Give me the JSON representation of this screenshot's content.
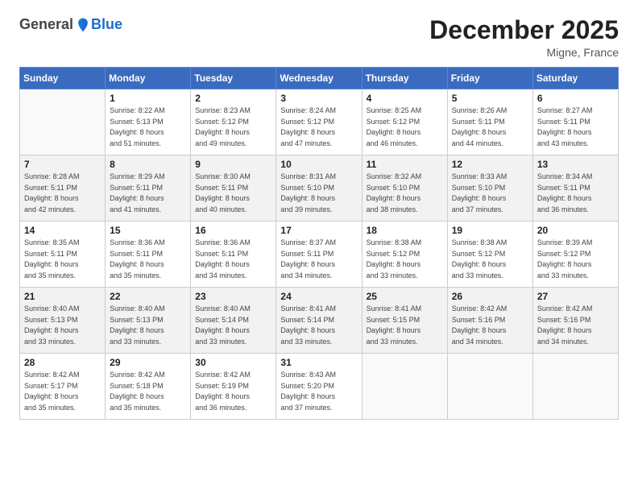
{
  "header": {
    "logo": {
      "general": "General",
      "blue": "Blue"
    },
    "title": "December 2025",
    "location": "Migne, France"
  },
  "weekdays": [
    "Sunday",
    "Monday",
    "Tuesday",
    "Wednesday",
    "Thursday",
    "Friday",
    "Saturday"
  ],
  "weeks": [
    [
      {
        "day": "",
        "info": ""
      },
      {
        "day": "1",
        "info": "Sunrise: 8:22 AM\nSunset: 5:13 PM\nDaylight: 8 hours\nand 51 minutes."
      },
      {
        "day": "2",
        "info": "Sunrise: 8:23 AM\nSunset: 5:12 PM\nDaylight: 8 hours\nand 49 minutes."
      },
      {
        "day": "3",
        "info": "Sunrise: 8:24 AM\nSunset: 5:12 PM\nDaylight: 8 hours\nand 47 minutes."
      },
      {
        "day": "4",
        "info": "Sunrise: 8:25 AM\nSunset: 5:12 PM\nDaylight: 8 hours\nand 46 minutes."
      },
      {
        "day": "5",
        "info": "Sunrise: 8:26 AM\nSunset: 5:11 PM\nDaylight: 8 hours\nand 44 minutes."
      },
      {
        "day": "6",
        "info": "Sunrise: 8:27 AM\nSunset: 5:11 PM\nDaylight: 8 hours\nand 43 minutes."
      }
    ],
    [
      {
        "day": "7",
        "info": "Sunrise: 8:28 AM\nSunset: 5:11 PM\nDaylight: 8 hours\nand 42 minutes."
      },
      {
        "day": "8",
        "info": "Sunrise: 8:29 AM\nSunset: 5:11 PM\nDaylight: 8 hours\nand 41 minutes."
      },
      {
        "day": "9",
        "info": "Sunrise: 8:30 AM\nSunset: 5:11 PM\nDaylight: 8 hours\nand 40 minutes."
      },
      {
        "day": "10",
        "info": "Sunrise: 8:31 AM\nSunset: 5:10 PM\nDaylight: 8 hours\nand 39 minutes."
      },
      {
        "day": "11",
        "info": "Sunrise: 8:32 AM\nSunset: 5:10 PM\nDaylight: 8 hours\nand 38 minutes."
      },
      {
        "day": "12",
        "info": "Sunrise: 8:33 AM\nSunset: 5:10 PM\nDaylight: 8 hours\nand 37 minutes."
      },
      {
        "day": "13",
        "info": "Sunrise: 8:34 AM\nSunset: 5:11 PM\nDaylight: 8 hours\nand 36 minutes."
      }
    ],
    [
      {
        "day": "14",
        "info": "Sunrise: 8:35 AM\nSunset: 5:11 PM\nDaylight: 8 hours\nand 35 minutes."
      },
      {
        "day": "15",
        "info": "Sunrise: 8:36 AM\nSunset: 5:11 PM\nDaylight: 8 hours\nand 35 minutes."
      },
      {
        "day": "16",
        "info": "Sunrise: 8:36 AM\nSunset: 5:11 PM\nDaylight: 8 hours\nand 34 minutes."
      },
      {
        "day": "17",
        "info": "Sunrise: 8:37 AM\nSunset: 5:11 PM\nDaylight: 8 hours\nand 34 minutes."
      },
      {
        "day": "18",
        "info": "Sunrise: 8:38 AM\nSunset: 5:12 PM\nDaylight: 8 hours\nand 33 minutes."
      },
      {
        "day": "19",
        "info": "Sunrise: 8:38 AM\nSunset: 5:12 PM\nDaylight: 8 hours\nand 33 minutes."
      },
      {
        "day": "20",
        "info": "Sunrise: 8:39 AM\nSunset: 5:12 PM\nDaylight: 8 hours\nand 33 minutes."
      }
    ],
    [
      {
        "day": "21",
        "info": "Sunrise: 8:40 AM\nSunset: 5:13 PM\nDaylight: 8 hours\nand 33 minutes."
      },
      {
        "day": "22",
        "info": "Sunrise: 8:40 AM\nSunset: 5:13 PM\nDaylight: 8 hours\nand 33 minutes."
      },
      {
        "day": "23",
        "info": "Sunrise: 8:40 AM\nSunset: 5:14 PM\nDaylight: 8 hours\nand 33 minutes."
      },
      {
        "day": "24",
        "info": "Sunrise: 8:41 AM\nSunset: 5:14 PM\nDaylight: 8 hours\nand 33 minutes."
      },
      {
        "day": "25",
        "info": "Sunrise: 8:41 AM\nSunset: 5:15 PM\nDaylight: 8 hours\nand 33 minutes."
      },
      {
        "day": "26",
        "info": "Sunrise: 8:42 AM\nSunset: 5:16 PM\nDaylight: 8 hours\nand 34 minutes."
      },
      {
        "day": "27",
        "info": "Sunrise: 8:42 AM\nSunset: 5:16 PM\nDaylight: 8 hours\nand 34 minutes."
      }
    ],
    [
      {
        "day": "28",
        "info": "Sunrise: 8:42 AM\nSunset: 5:17 PM\nDaylight: 8 hours\nand 35 minutes."
      },
      {
        "day": "29",
        "info": "Sunrise: 8:42 AM\nSunset: 5:18 PM\nDaylight: 8 hours\nand 35 minutes."
      },
      {
        "day": "30",
        "info": "Sunrise: 8:42 AM\nSunset: 5:19 PM\nDaylight: 8 hours\nand 36 minutes."
      },
      {
        "day": "31",
        "info": "Sunrise: 8:43 AM\nSunset: 5:20 PM\nDaylight: 8 hours\nand 37 minutes."
      },
      {
        "day": "",
        "info": ""
      },
      {
        "day": "",
        "info": ""
      },
      {
        "day": "",
        "info": ""
      }
    ]
  ]
}
